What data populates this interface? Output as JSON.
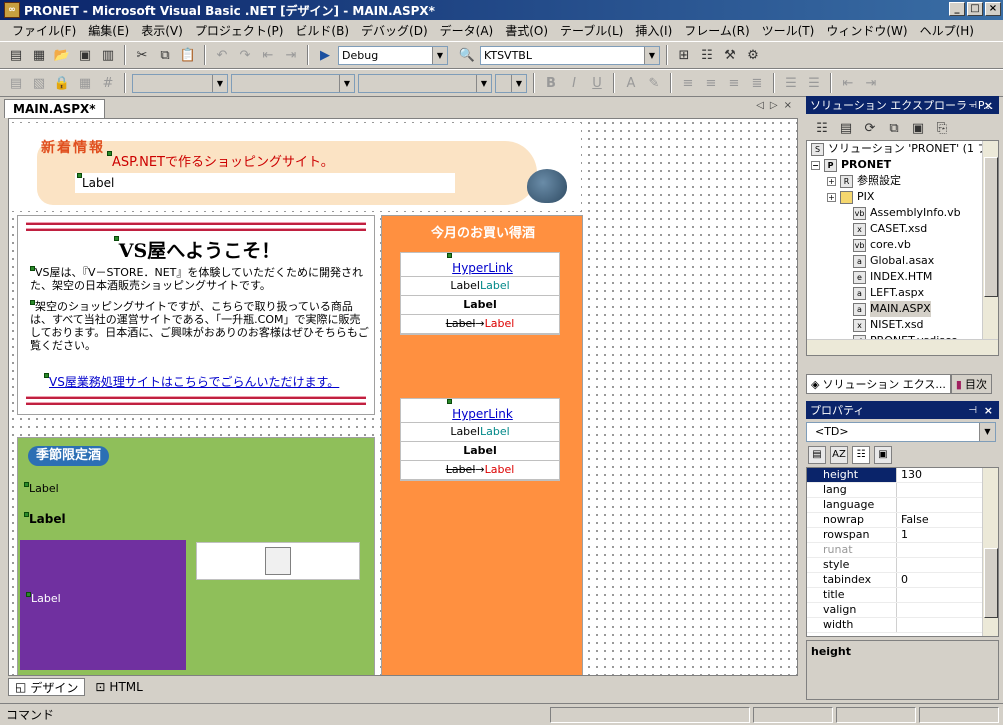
{
  "window": {
    "title": "PRONET - Microsoft Visual Basic .NET [デザイン] - MAIN.ASPX*",
    "min": "_",
    "max": "□",
    "close": "×"
  },
  "menu": [
    "ファイル(F)",
    "編集(E)",
    "表示(V)",
    "プロジェクト(P)",
    "ビルド(B)",
    "デバッグ(D)",
    "データ(A)",
    "書式(O)",
    "テーブル(L)",
    "挿入(I)",
    "フレーム(R)",
    "ツール(T)",
    "ウィンドウ(W)",
    "ヘルプ(H)"
  ],
  "toolbar": {
    "config": "Debug",
    "target": "KTSVTBL"
  },
  "document": {
    "tab": "MAIN.ASPX*"
  },
  "page": {
    "shinchaku": "新着情報",
    "news_text": "ASP.NETで作るショッピングサイト。",
    "label": "Label",
    "welcome_title": "VS屋へようこそ！",
    "welcome_p1": "VS屋は、『V－STORE．NET』を体験していただくために開発された、架空の日本酒販売ショッピングサイトです。",
    "welcome_p2": "架空のショッピングサイトですが、こちらで取り扱っている商品は、すべて当社の運営サイトである、「一升瓶.COM」で実際に販売しております。日本酒に、ご興味がおありのお客様はぜひそちらもご覧ください。",
    "welcome_link": "VS屋業務処理サイトはこちらでごらんいただけます。",
    "monthly_title": "今月のお買い得酒",
    "hyperlink": "HyperLink",
    "arrow": "→",
    "seasonal_title": "季節限定酒"
  },
  "solution": {
    "header": "ソリューション エクスプローラ - P...",
    "items": [
      {
        "label": "ソリューション 'PRONET' (1 プ",
        "icon": "solution-icon"
      },
      {
        "label": "PRONET",
        "icon": "project-icon"
      },
      {
        "label": "参照設定",
        "icon": "references-icon"
      },
      {
        "label": "PIX",
        "icon": "folder-icon"
      },
      {
        "label": "AssemblyInfo.vb",
        "icon": "vb-file-icon"
      },
      {
        "label": "CASET.xsd",
        "icon": "xsd-file-icon"
      },
      {
        "label": "core.vb",
        "icon": "vb-file-icon"
      },
      {
        "label": "Global.asax",
        "icon": "asax-file-icon"
      },
      {
        "label": "INDEX.HTM",
        "icon": "htm-file-icon"
      },
      {
        "label": "LEFT.aspx",
        "icon": "aspx-file-icon"
      },
      {
        "label": "MAIN.ASPX",
        "icon": "aspx-file-icon"
      },
      {
        "label": "NISET.xsd",
        "icon": "xsd-file-icon"
      },
      {
        "label": "PRONET.vsdisco",
        "icon": "vsdisco-file-icon"
      }
    ],
    "tab_solution": "ソリューション エクス...",
    "tab_index": "目次"
  },
  "properties": {
    "header": "プロパティ",
    "object": "<TD>",
    "rows": [
      {
        "name": "height",
        "value": "130"
      },
      {
        "name": "lang",
        "value": ""
      },
      {
        "name": "language",
        "value": ""
      },
      {
        "name": "nowrap",
        "value": "False"
      },
      {
        "name": "rowspan",
        "value": "1"
      },
      {
        "name": "runat",
        "value": ""
      },
      {
        "name": "style",
        "value": ""
      },
      {
        "name": "tabindex",
        "value": "0"
      },
      {
        "name": "title",
        "value": ""
      },
      {
        "name": "valign",
        "value": ""
      },
      {
        "name": "width",
        "value": ""
      }
    ],
    "description": "height"
  },
  "views": {
    "design": "デザイン",
    "html": "HTML"
  },
  "status": {
    "text": "コマンド"
  }
}
